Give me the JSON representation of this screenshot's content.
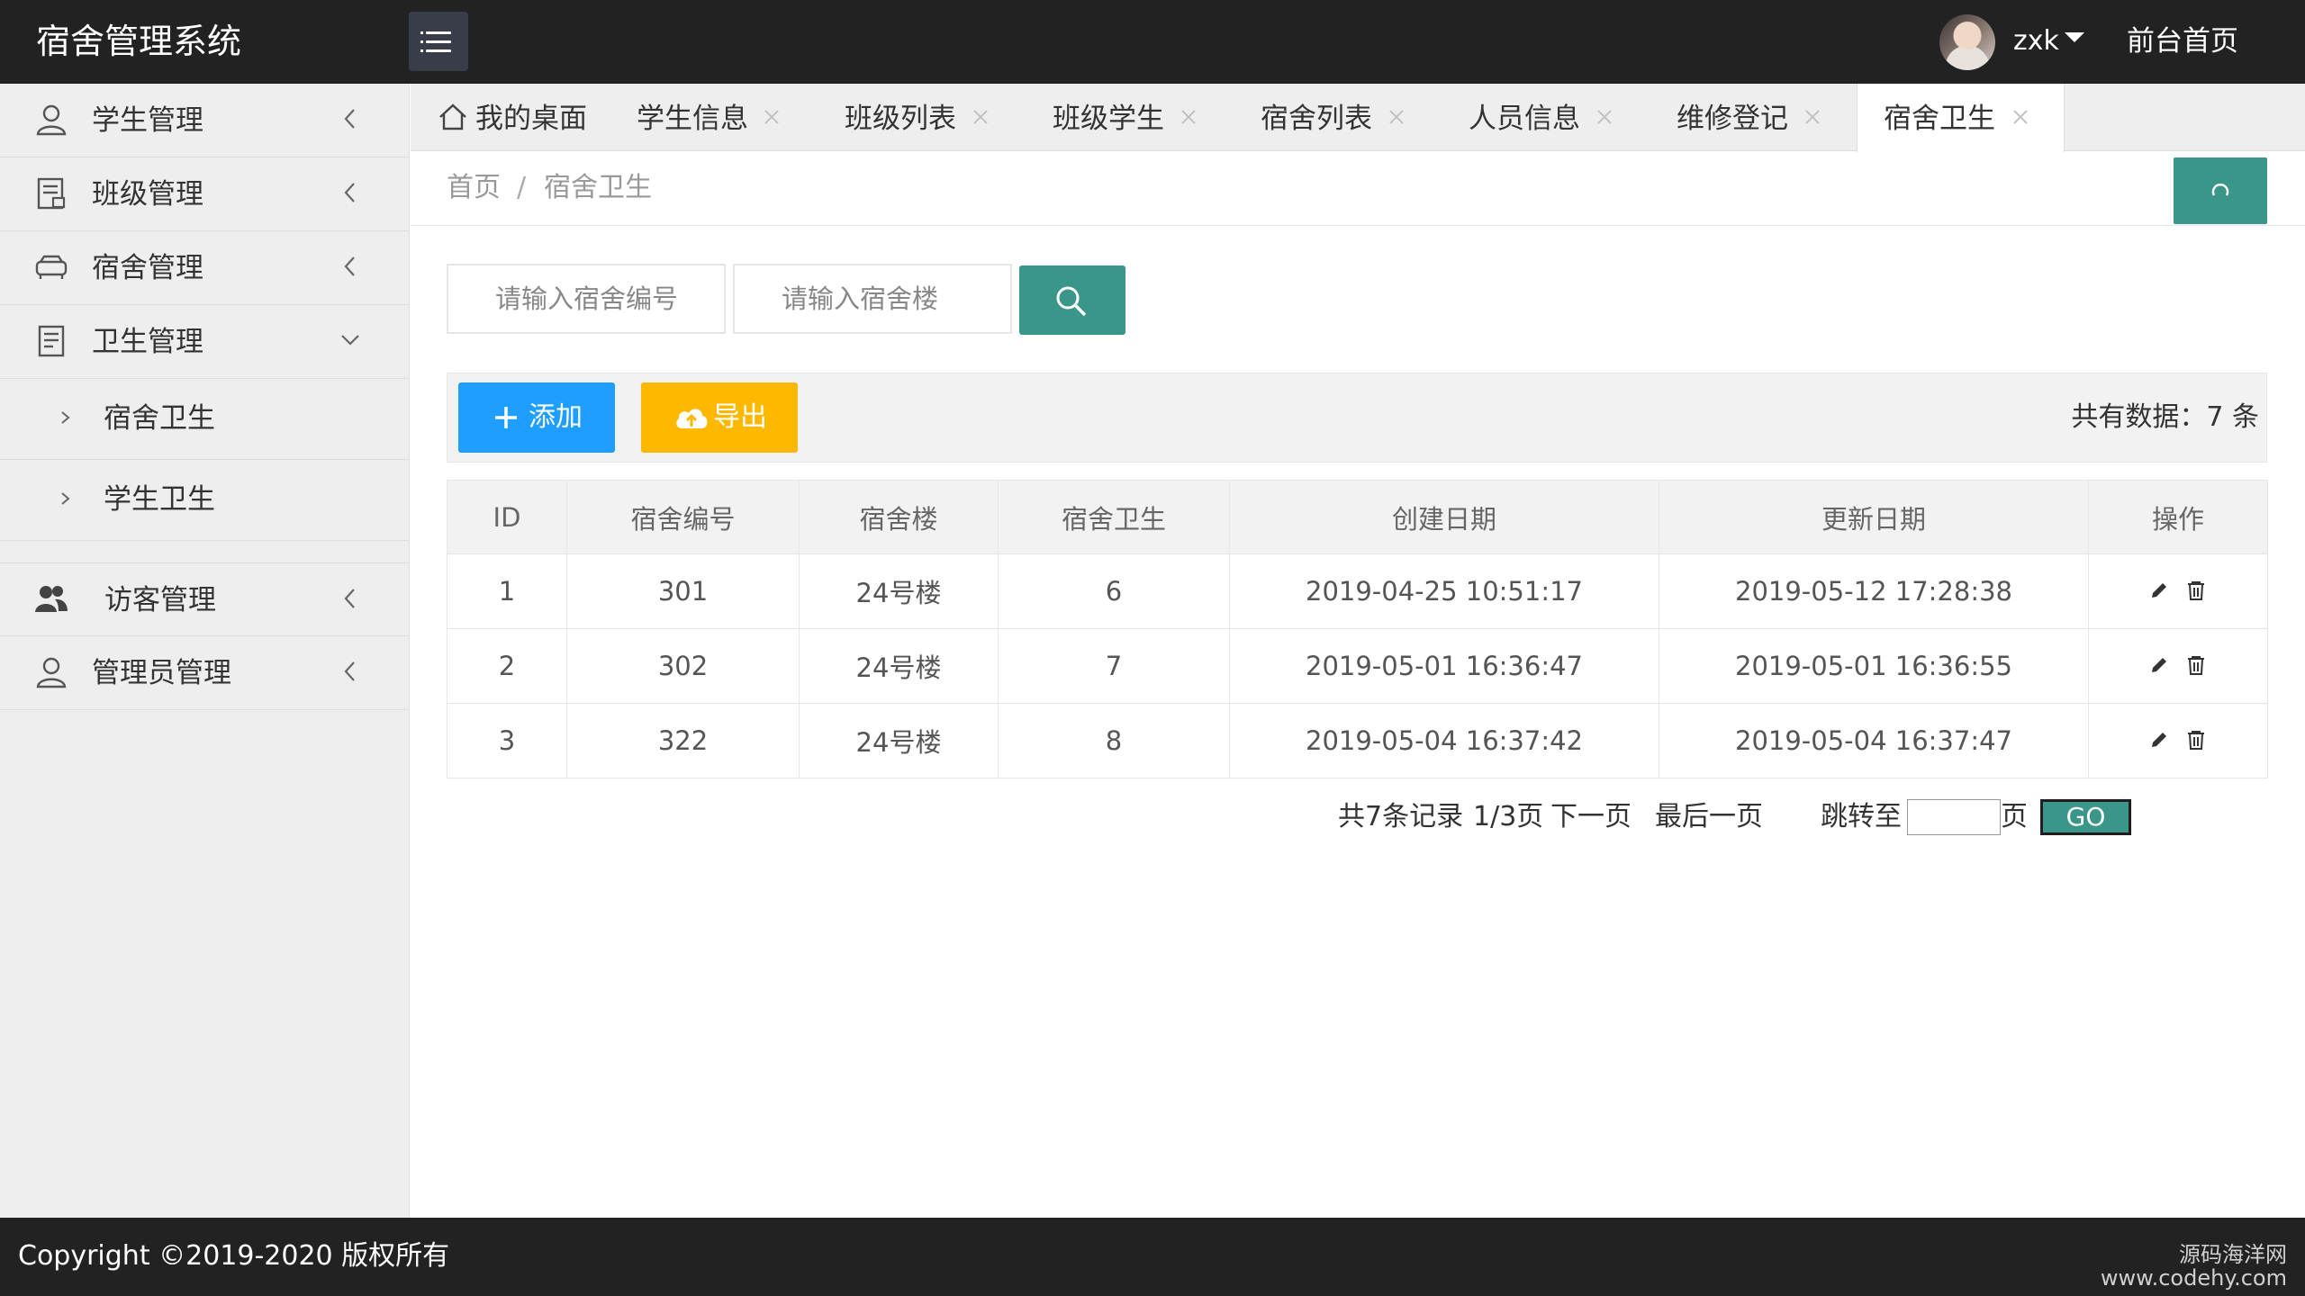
{
  "header": {
    "app_title": "宿舍管理系统",
    "user_name": "zxk",
    "front_link": "前台首页"
  },
  "sidebar": {
    "items": [
      {
        "label": "学生管理",
        "icon": "user-icon",
        "expanded": false
      },
      {
        "label": "班级管理",
        "icon": "document-icon",
        "expanded": false
      },
      {
        "label": "宿舍管理",
        "icon": "sofa-icon",
        "expanded": false
      },
      {
        "label": "卫生管理",
        "icon": "report-icon",
        "expanded": true,
        "children": [
          {
            "label": "宿舍卫生"
          },
          {
            "label": "学生卫生"
          }
        ]
      },
      {
        "label": "访客管理",
        "icon": "group-icon",
        "expanded": false
      },
      {
        "label": "管理员管理",
        "icon": "user-icon",
        "expanded": false
      }
    ]
  },
  "tabs": [
    {
      "label": "我的桌面",
      "closable": false,
      "active": false
    },
    {
      "label": "学生信息",
      "closable": true,
      "active": false
    },
    {
      "label": "班级列表",
      "closable": true,
      "active": false
    },
    {
      "label": "班级学生",
      "closable": true,
      "active": false
    },
    {
      "label": "宿舍列表",
      "closable": true,
      "active": false
    },
    {
      "label": "人员信息",
      "closable": true,
      "active": false
    },
    {
      "label": "维修登记",
      "closable": true,
      "active": false
    },
    {
      "label": "宿舍卫生",
      "closable": true,
      "active": true
    }
  ],
  "breadcrumb": {
    "home": "首页",
    "separator": "/",
    "current": "宿舍卫生"
  },
  "search": {
    "dorm_no_placeholder": "请输入宿舍编号",
    "building_placeholder": "请输入宿舍楼"
  },
  "toolbar": {
    "add_label": "添加",
    "export_label": "导出",
    "total_text": "共有数据：7 条"
  },
  "table": {
    "columns": [
      "ID",
      "宿舍编号",
      "宿舍楼",
      "宿舍卫生",
      "创建日期",
      "更新日期",
      "操作"
    ],
    "rows": [
      [
        "1",
        "301",
        "24号楼",
        "6",
        "2019-04-25 10:51:17",
        "2019-05-12 17:28:38"
      ],
      [
        "2",
        "302",
        "24号楼",
        "7",
        "2019-05-01 16:36:47",
        "2019-05-01 16:36:55"
      ],
      [
        "3",
        "322",
        "24号楼",
        "8",
        "2019-05-04 16:37:42",
        "2019-05-04 16:37:47"
      ]
    ]
  },
  "pagination": {
    "total_records": "共7条记录",
    "page_info": "1/3页",
    "next": "下一页",
    "last": "最后一页",
    "jump_to": "跳转至",
    "page_unit": "页",
    "go": "GO"
  },
  "footer": {
    "copyright": "Copyright ©2019-2020 版权所有",
    "watermark_line1": "源码海洋网",
    "watermark_line2": "www.codehy.com"
  },
  "colors": {
    "header_bg": "#222222",
    "primary_teal": "#3a9688",
    "add_blue": "#1e9fff",
    "export_yellow": "#ffb800",
    "sidebar_bg": "#eeeeee"
  }
}
